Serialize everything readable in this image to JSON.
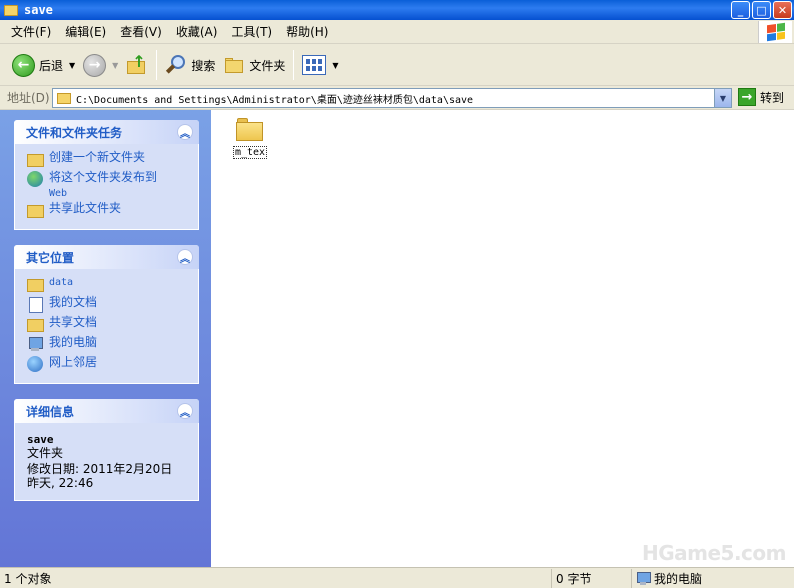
{
  "window": {
    "title": "save"
  },
  "menu": [
    "文件(F)",
    "编辑(E)",
    "查看(V)",
    "收藏(A)",
    "工具(T)",
    "帮助(H)"
  ],
  "toolbar": {
    "back_label": "后退",
    "search_label": "搜索",
    "folders_label": "文件夹"
  },
  "address": {
    "label": "地址(D)",
    "path": "C:\\Documents and Settings\\Administrator\\桌面\\迹迹丝袜材质包\\data\\save",
    "go_label": "转到"
  },
  "tasks_panel": {
    "title": "文件和文件夹任务",
    "links": [
      {
        "icon": "new-folder-icon",
        "label": "创建一个新文件夹"
      },
      {
        "icon": "publish-web-icon",
        "label": "将这个文件夹发布到",
        "label2": "Web"
      },
      {
        "icon": "share-folder-icon",
        "label": "共享此文件夹"
      }
    ]
  },
  "places_panel": {
    "title": "其它位置",
    "links": [
      {
        "icon": "folder-icon",
        "label": "data"
      },
      {
        "icon": "my-documents-icon",
        "label": "我的文档"
      },
      {
        "icon": "shared-documents-icon",
        "label": "共享文档"
      },
      {
        "icon": "my-computer-icon",
        "label": "我的电脑"
      },
      {
        "icon": "network-places-icon",
        "label": "网上邻居"
      }
    ]
  },
  "details_panel": {
    "title": "详细信息",
    "name": "save",
    "type": "文件夹",
    "modified": "修改日期: 2011年2月20日",
    "modified2": "昨天, 22:46"
  },
  "content": {
    "items": [
      {
        "icon": "folder-icon",
        "label": "m_tex"
      }
    ],
    "watermark": "HGame5.com"
  },
  "status": {
    "objects": "1 个对象",
    "size": "0 字节",
    "location": "我的电脑"
  }
}
